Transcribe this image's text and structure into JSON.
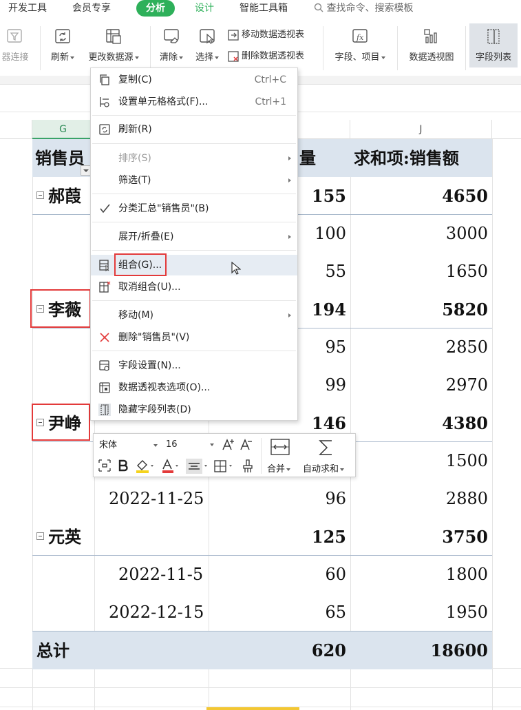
{
  "tabs": {
    "items": [
      "开发工具",
      "会员专享",
      "分析",
      "设计",
      "智能工具箱"
    ],
    "search_label": "查找命令、搜索模板"
  },
  "ribbon": {
    "filter_connect": "器连接",
    "refresh": "刷新",
    "change_source": "更改数据源",
    "clear": "清除",
    "select": "选择",
    "move_pivot": "移动数据透视表",
    "delete_pivot": "删除数据透视表",
    "fields_items": "字段、项目",
    "pivot_chart": "数据透视图",
    "field_list": "字段列表"
  },
  "colors": {
    "accent": "#2eb05a",
    "band": "#dbe4ee",
    "highlight": "#e33a3a"
  },
  "columns": {
    "g": "G",
    "j": "J"
  },
  "sheet": {
    "header": {
      "salesperson": "销售员",
      "qty_tail": "量",
      "sum_sales": "求和项:销售额"
    },
    "rows": [
      {
        "label": "郝葭",
        "qty": "155",
        "sales": "4650",
        "group": true
      },
      {
        "label": "",
        "qty": "100",
        "sales": "3000",
        "group": false
      },
      {
        "label": "",
        "qty": "55",
        "sales": "1650",
        "group": false
      },
      {
        "label": "李薇",
        "qty": "194",
        "sales": "5820",
        "group": true
      },
      {
        "label": "",
        "qty": "95",
        "sales": "2850",
        "group": false
      },
      {
        "label": "",
        "qty": "99",
        "sales": "2970",
        "group": false
      },
      {
        "label": "尹峥",
        "qty": "146",
        "sales": "4380",
        "group": true
      },
      {
        "label": "",
        "qty": "",
        "sales": "1500",
        "group": false
      },
      {
        "label": "2022-11-25",
        "qty": "96",
        "sales": "2880",
        "group": false
      },
      {
        "label": "元英",
        "qty": "125",
        "sales": "3750",
        "group": true
      },
      {
        "label": "2022-11-5",
        "qty": "60",
        "sales": "1800",
        "group": false
      },
      {
        "label": "2022-12-15",
        "qty": "65",
        "sales": "1950",
        "group": false
      }
    ],
    "total": {
      "label": "总计",
      "qty": "620",
      "sales": "18600"
    }
  },
  "context_menu": {
    "copy": "复制(C)",
    "copy_shortcut": "Ctrl+C",
    "format_cells": "设置单元格格式(F)...",
    "format_shortcut": "Ctrl+1",
    "refresh": "刷新(R)",
    "sort": "排序(S)",
    "filter": "筛选(T)",
    "subtotal": "分类汇总\"销售员\"(B)",
    "expand": "展开/折叠(E)",
    "group": "组合(G)...",
    "ungroup": "取消组合(U)...",
    "move": "移动(M)",
    "delete": "删除\"销售员\"(V)",
    "field_settings": "字段设置(N)...",
    "pivot_options": "数据透视表选项(O)...",
    "hide_field_list": "隐藏字段列表(D)"
  },
  "mini_toolbar": {
    "font": "宋体",
    "size": "16",
    "merge": "合并",
    "autosum": "自动求和"
  }
}
